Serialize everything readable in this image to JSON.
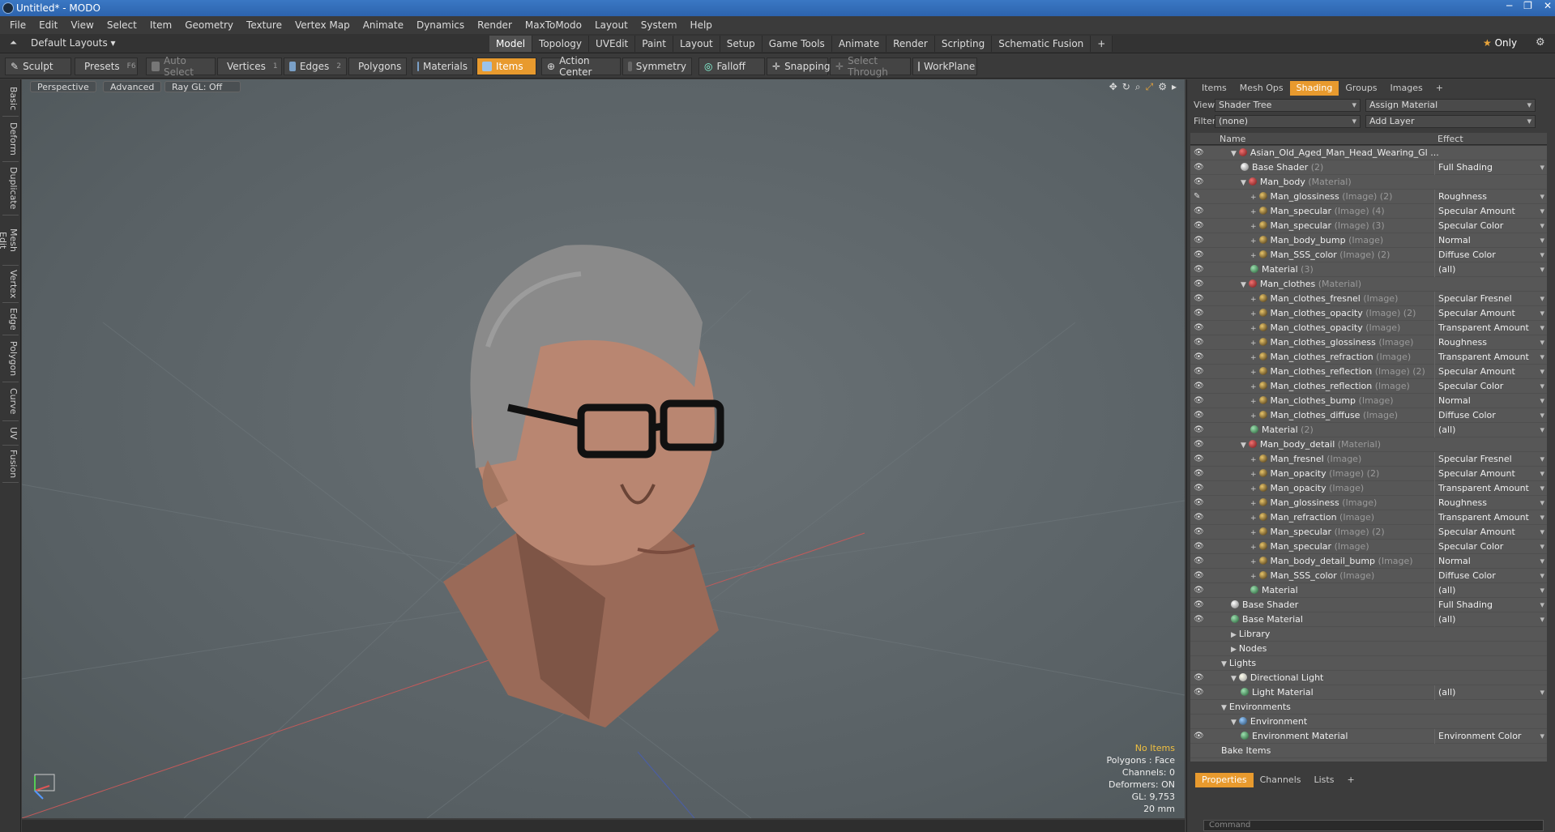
{
  "window": {
    "title": "Untitled* - MODO",
    "controls": [
      "─",
      "❐",
      "✕"
    ]
  },
  "menu": [
    "File",
    "Edit",
    "View",
    "Select",
    "Item",
    "Geometry",
    "Texture",
    "Vertex Map",
    "Animate",
    "Dynamics",
    "Render",
    "MaxToModo",
    "Layout",
    "System",
    "Help"
  ],
  "layout": {
    "preset": "Default Layouts ▾",
    "tabs": [
      "Model",
      "Topology",
      "UVEdit",
      "Paint",
      "Layout",
      "Setup",
      "Game Tools",
      "Animate",
      "Render",
      "Scripting",
      "Schematic Fusion",
      "+"
    ],
    "active_tab": "Model",
    "only_label": "Only"
  },
  "toolbar": {
    "sculpt": "Sculpt",
    "presets": "Presets",
    "presets_key": "F6",
    "auto_select": "Auto Select",
    "vertices": "Vertices",
    "vertices_num": "1",
    "edges": "Edges",
    "edges_num": "2",
    "polygons": "Polygons",
    "materials": "Materials",
    "items": "Items",
    "action_center": "Action Center",
    "symmetry": "Symmetry",
    "falloff": "Falloff",
    "snapping": "Snapping",
    "select_through": "Select Through",
    "workplane": "WorkPlane"
  },
  "left_tabs": [
    "Basic",
    "Deform",
    "Duplicate",
    "Mesh Edit",
    "Vertex",
    "Edge",
    "Polygon",
    "Curve",
    "UV",
    "Fusion"
  ],
  "viewport": {
    "view": "Perspective",
    "mode": "Advanced",
    "raygl": "Ray GL: Off",
    "stats": {
      "items": "No Items",
      "polygons": "Polygons : Face",
      "channels": "Channels: 0",
      "deformers": "Deformers: ON",
      "gl": "GL: 9,753",
      "unit": "20 mm"
    }
  },
  "right_panel": {
    "tabs": [
      "Items",
      "Mesh Ops",
      "Shading",
      "Groups",
      "Images",
      "+"
    ],
    "active_tab": "Shading",
    "view_label": "View",
    "view_value": "Shader Tree",
    "assign": "Assign Material",
    "filter_label": "Filter",
    "filter_value": "(none)",
    "add_layer": "Add Layer",
    "col_name": "Name",
    "col_effect": "Effect",
    "rows": [
      {
        "indent": 0,
        "tri": "▼",
        "ball": "grp",
        "name": "Asian_Old_Aged_Man_Head_Wearing_Gl ...",
        "kind": "",
        "effect": "",
        "eye": "👁"
      },
      {
        "indent": 1,
        "tri": "",
        "ball": "shd",
        "name": "Base Shader",
        "kind": " (2)",
        "effect": "Full Shading",
        "eye": "👁"
      },
      {
        "indent": 1,
        "tri": "▼",
        "ball": "grp",
        "name": "Man_body",
        "kind": " (Material)",
        "effect": "",
        "eye": "👁"
      },
      {
        "indent": 2,
        "tri": "+",
        "ball": "img",
        "name": "Man_glossiness",
        "kind": " (Image) (2)",
        "effect": "Roughness",
        "eye": "✎"
      },
      {
        "indent": 2,
        "tri": "+",
        "ball": "img",
        "name": "Man_specular",
        "kind": " (Image) (4)",
        "effect": "Specular Amount",
        "eye": "👁"
      },
      {
        "indent": 2,
        "tri": "+",
        "ball": "img",
        "name": "Man_specular",
        "kind": " (Image) (3)",
        "effect": "Specular Color",
        "eye": "👁"
      },
      {
        "indent": 2,
        "tri": "+",
        "ball": "img",
        "name": "Man_body_bump",
        "kind": " (Image)",
        "effect": "Normal",
        "eye": "👁"
      },
      {
        "indent": 2,
        "tri": "+",
        "ball": "img",
        "name": "Man_SSS_color",
        "kind": " (Image) (2)",
        "effect": "Diffuse Color",
        "eye": "👁"
      },
      {
        "indent": 2,
        "tri": "",
        "ball": "mat",
        "name": "Material",
        "kind": " (3)",
        "effect": "(all)",
        "eye": "👁"
      },
      {
        "indent": 1,
        "tri": "▼",
        "ball": "grp",
        "name": "Man_clothes",
        "kind": " (Material)",
        "effect": "",
        "eye": "👁"
      },
      {
        "indent": 2,
        "tri": "+",
        "ball": "img",
        "name": "Man_clothes_fresnel",
        "kind": " (Image)",
        "effect": "Specular Fresnel",
        "eye": "👁"
      },
      {
        "indent": 2,
        "tri": "+",
        "ball": "img",
        "name": "Man_clothes_opacity",
        "kind": " (Image) (2)",
        "effect": "Specular Amount",
        "eye": "👁"
      },
      {
        "indent": 2,
        "tri": "+",
        "ball": "img",
        "name": "Man_clothes_opacity",
        "kind": " (Image)",
        "effect": "Transparent Amount",
        "eye": "👁"
      },
      {
        "indent": 2,
        "tri": "+",
        "ball": "img",
        "name": "Man_clothes_glossiness",
        "kind": " (Image)",
        "effect": "Roughness",
        "eye": "👁"
      },
      {
        "indent": 2,
        "tri": "+",
        "ball": "img",
        "name": "Man_clothes_refraction",
        "kind": " (Image)",
        "effect": "Transparent Amount",
        "eye": "👁"
      },
      {
        "indent": 2,
        "tri": "+",
        "ball": "img",
        "name": "Man_clothes_reflection",
        "kind": " (Image) (2)",
        "effect": "Specular Amount",
        "eye": "👁"
      },
      {
        "indent": 2,
        "tri": "+",
        "ball": "img",
        "name": "Man_clothes_reflection",
        "kind": " (Image)",
        "effect": "Specular Color",
        "eye": "👁"
      },
      {
        "indent": 2,
        "tri": "+",
        "ball": "img",
        "name": "Man_clothes_bump",
        "kind": " (Image)",
        "effect": "Normal",
        "eye": "👁"
      },
      {
        "indent": 2,
        "tri": "+",
        "ball": "img",
        "name": "Man_clothes_diffuse",
        "kind": " (Image)",
        "effect": "Diffuse Color",
        "eye": "👁"
      },
      {
        "indent": 2,
        "tri": "",
        "ball": "mat",
        "name": "Material",
        "kind": " (2)",
        "effect": "(all)",
        "eye": "👁"
      },
      {
        "indent": 1,
        "tri": "▼",
        "ball": "grp",
        "name": "Man_body_detail",
        "kind": " (Material)",
        "effect": "",
        "eye": "👁"
      },
      {
        "indent": 2,
        "tri": "+",
        "ball": "img",
        "name": "Man_fresnel",
        "kind": " (Image)",
        "effect": "Specular Fresnel",
        "eye": "👁"
      },
      {
        "indent": 2,
        "tri": "+",
        "ball": "img",
        "name": "Man_opacity",
        "kind": " (Image) (2)",
        "effect": "Specular Amount",
        "eye": "👁"
      },
      {
        "indent": 2,
        "tri": "+",
        "ball": "img",
        "name": "Man_opacity",
        "kind": " (Image)",
        "effect": "Transparent Amount",
        "eye": "👁"
      },
      {
        "indent": 2,
        "tri": "+",
        "ball": "img",
        "name": "Man_glossiness",
        "kind": " (Image)",
        "effect": "Roughness",
        "eye": "👁"
      },
      {
        "indent": 2,
        "tri": "+",
        "ball": "img",
        "name": "Man_refraction",
        "kind": " (Image)",
        "effect": "Transparent Amount",
        "eye": "👁"
      },
      {
        "indent": 2,
        "tri": "+",
        "ball": "img",
        "name": "Man_specular",
        "kind": " (Image) (2)",
        "effect": "Specular Amount",
        "eye": "👁"
      },
      {
        "indent": 2,
        "tri": "+",
        "ball": "img",
        "name": "Man_specular",
        "kind": " (Image)",
        "effect": "Specular Color",
        "eye": "👁"
      },
      {
        "indent": 2,
        "tri": "+",
        "ball": "img",
        "name": "Man_body_detail_bump",
        "kind": " (Image)",
        "effect": "Normal",
        "eye": "👁"
      },
      {
        "indent": 2,
        "tri": "+",
        "ball": "img",
        "name": "Man_SSS_color",
        "kind": " (Image)",
        "effect": "Diffuse Color",
        "eye": "👁"
      },
      {
        "indent": 2,
        "tri": "",
        "ball": "mat",
        "name": "Material",
        "kind": "",
        "effect": "(all)",
        "eye": "👁"
      },
      {
        "indent": 0,
        "tri": "",
        "ball": "shd",
        "name": "Base Shader",
        "kind": "",
        "effect": "Full Shading",
        "eye": "👁"
      },
      {
        "indent": 0,
        "tri": "",
        "ball": "mat",
        "name": "Base Material",
        "kind": "",
        "effect": "(all)",
        "eye": "👁"
      },
      {
        "indent": 0,
        "tri": "▶",
        "ball": "",
        "name": "Library",
        "kind": "",
        "effect": "",
        "eye": ""
      },
      {
        "indent": 0,
        "tri": "▶",
        "ball": "",
        "name": "Nodes",
        "kind": "",
        "effect": "",
        "eye": ""
      },
      {
        "indent": -1,
        "tri": "▼",
        "ball": "",
        "name": "Lights",
        "kind": "",
        "effect": "",
        "eye": ""
      },
      {
        "indent": 0,
        "tri": "▼",
        "ball": "lgt",
        "name": "Directional Light",
        "kind": "",
        "effect": "",
        "eye": "👁"
      },
      {
        "indent": 1,
        "tri": "",
        "ball": "mat",
        "name": "Light Material",
        "kind": "",
        "effect": "(all)",
        "eye": "👁"
      },
      {
        "indent": -1,
        "tri": "▼",
        "ball": "",
        "name": "Environments",
        "kind": "",
        "effect": "",
        "eye": ""
      },
      {
        "indent": 0,
        "tri": "▼",
        "ball": "env",
        "name": "Environment",
        "kind": "",
        "effect": "",
        "eye": ""
      },
      {
        "indent": 1,
        "tri": "",
        "ball": "mat",
        "name": "Environment Material",
        "kind": "",
        "effect": "Environment Color",
        "eye": "👁"
      },
      {
        "indent": -1,
        "tri": "",
        "ball": "",
        "name": "Bake Items",
        "kind": "",
        "effect": "",
        "eye": ""
      }
    ],
    "bottom_tabs": [
      "Properties",
      "Channels",
      "Lists",
      "+"
    ],
    "bottom_active": "Properties",
    "command_placeholder": "Command"
  },
  "colors": {
    "accent": "#e89a2e",
    "titlebar": "#2d63ad",
    "viewport": "#5f676a"
  }
}
